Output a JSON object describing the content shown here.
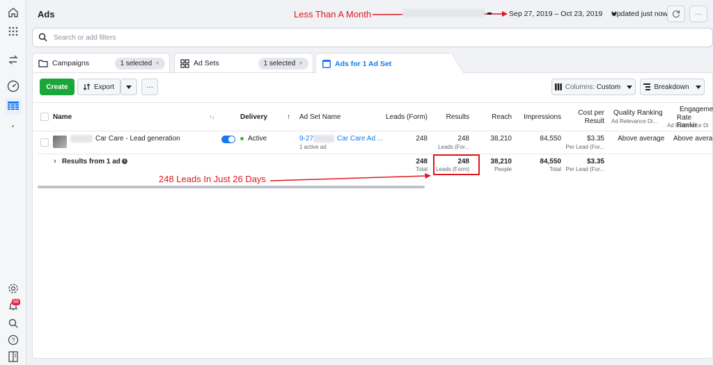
{
  "header": {
    "title": "Ads",
    "annotation_top": "Less Than A Month",
    "date_range": "Sep 27, 2019 – Oct 23, 2019",
    "updated": "Updated just now",
    "more": "···"
  },
  "rail": {
    "icons": [
      "home-icon",
      "apps-grid-icon",
      "swap-icon",
      "gauge-icon",
      "table-icon",
      "settings-icon",
      "bell-icon",
      "search-icon",
      "help-icon",
      "panel-icon"
    ],
    "notification_count": "99"
  },
  "search": {
    "placeholder": "Search or add filters"
  },
  "tabs": [
    {
      "label": "Campaigns",
      "pill": "1 selected",
      "close": "×"
    },
    {
      "label": "Ad Sets",
      "pill": "1 selected",
      "close": "×"
    },
    {
      "label": "Ads for 1 Ad Set"
    }
  ],
  "toolbar": {
    "create": "Create",
    "export": "Export",
    "more": "···",
    "columns_prefix": "Columns:",
    "columns_value": "Custom",
    "breakdown": "Breakdown"
  },
  "table": {
    "headers": {
      "name": "Name",
      "sort": "↑↓",
      "delivery": "Delivery",
      "delivery_arrow": "↑",
      "adset": "Ad Set Name",
      "leads": "Leads (Form)",
      "results": "Results",
      "reach": "Reach",
      "impressions": "Impressions",
      "cost_l1": "Cost per",
      "cost_l2": "Result",
      "quality": "Quality Ranking",
      "quality_sub": "Ad Relevance Di...",
      "engage_l1": "Engageme",
      "engage_l2": "Rate Rankir",
      "engage_sub": "Ad Relevance Di"
    },
    "row": {
      "name": "Car Care - Lead generation",
      "delivery": "Active",
      "adset_prefix": "9-27",
      "adset_suffix": "Car Care Ad ...",
      "adset_sub": "1 active ad",
      "leads": "248",
      "results": "248",
      "results_sub": "Leads (For...",
      "reach": "38,210",
      "impressions": "84,550",
      "cost": "$3.35",
      "cost_sub": "Per Lead (For...",
      "quality": "Above average",
      "engage": "Above avera"
    },
    "summary": {
      "label": "Results from 1 ad",
      "leads": "248",
      "leads_sub": "Total",
      "results": "248",
      "results_sub": "Leads (Form)",
      "reach": "38,210",
      "reach_sub": "People",
      "impressions": "84,550",
      "impressions_sub": "Total",
      "cost": "$3.35",
      "cost_sub": "Per Lead (For..."
    }
  },
  "annotation_bottom": "248 Leads In Just 26 Days",
  "colors": {
    "accent": "#1877f2",
    "create": "#1ba53a",
    "annotation": "#e1161e"
  }
}
